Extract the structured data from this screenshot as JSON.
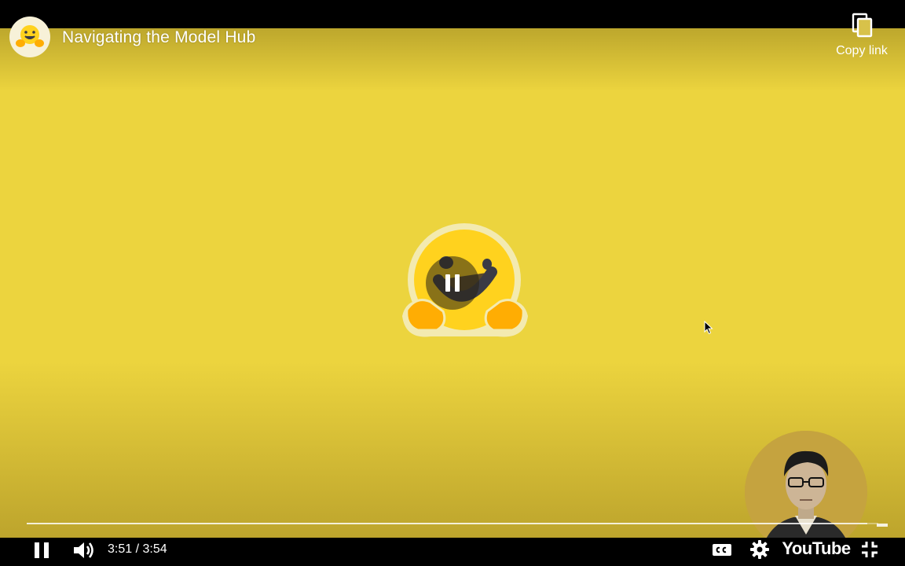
{
  "video": {
    "title": "Navigating the Model Hub",
    "background_color": "#ecd43e"
  },
  "top_bar": {
    "copy_link_label": "Copy link",
    "copy_icon": "copy-icon"
  },
  "center": {
    "logo": "hugging-face-emoji-logo",
    "state_icon": "pause-icon"
  },
  "controls": {
    "play_state_icon": "pause-icon",
    "volume_icon": "volume-icon",
    "time_display": "3:51 / 3:54",
    "current_time": "3:51",
    "duration": "3:54",
    "progress_fraction": 0.987,
    "captions_icon": "cc-icon",
    "settings_icon": "gear-icon",
    "brand": "YouTube",
    "fullscreen_icon": "exit-fullscreen-icon"
  },
  "colors": {
    "accent_yellow": "#ecd43e",
    "logo_yellow": "#ffd21e",
    "text_white": "#ffffff"
  }
}
